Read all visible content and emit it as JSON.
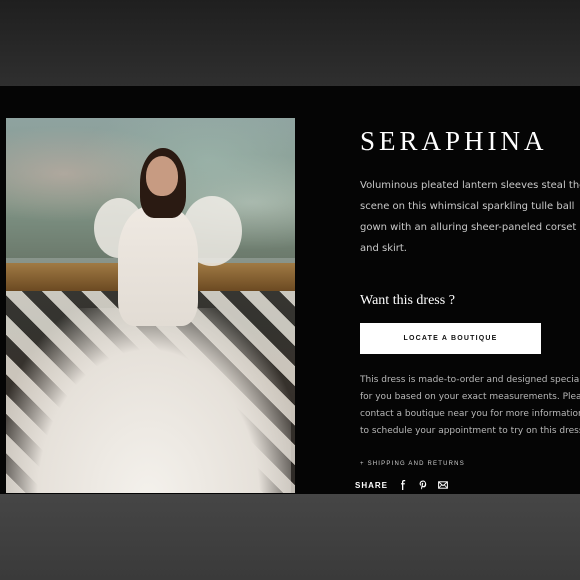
{
  "product": {
    "name": "SERAPHINA",
    "description_lines": [
      "Voluminous pleated lantern sleeves steal the",
      "scene on this whimsical sparkling tulle ball",
      "gown with an alluring sheer-paneled corset",
      "and skirt."
    ]
  },
  "cta": {
    "prompt": "Want this dress ?",
    "button_label": "LOCATE A BOUTIQUE"
  },
  "note_lines": [
    "This dress is made-to-order and designed specially",
    "for you based on your exact measurements. Please",
    "contact a boutique near you for more information or",
    "to schedule your appointment to try on this dress."
  ],
  "shipping_link": "+ SHIPPING AND RETURNS",
  "share": {
    "label": "SHARE",
    "icons": [
      "facebook-icon",
      "pinterest-icon",
      "email-icon"
    ]
  }
}
